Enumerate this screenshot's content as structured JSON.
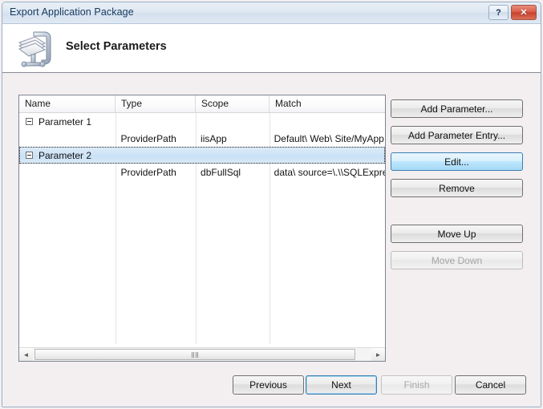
{
  "window": {
    "title": "Export Application Package",
    "help_button": "?",
    "close_button": "✕"
  },
  "header": {
    "title": "Select Parameters",
    "icon": "package-clamp-icon"
  },
  "grid": {
    "columns": [
      "Name",
      "Type",
      "Scope",
      "Match"
    ],
    "rows": [
      {
        "kind": "group",
        "name": "Parameter 1",
        "type": "",
        "scope": "",
        "match": "",
        "selected": false
      },
      {
        "kind": "entry",
        "name": "",
        "type": "ProviderPath",
        "scope": "iisApp",
        "match": "Default\\ Web\\ Site/MyApp",
        "selected": false
      },
      {
        "kind": "group",
        "name": "Parameter 2",
        "type": "",
        "scope": "",
        "match": "",
        "selected": true
      },
      {
        "kind": "entry",
        "name": "",
        "type": "ProviderPath",
        "scope": "dbFullSql",
        "match": "data\\ source=\\.\\\\SQLExpre",
        "selected": false
      }
    ],
    "scrollbar": {
      "left_arrow": "◄",
      "right_arrow": "►"
    }
  },
  "side_buttons": [
    {
      "label": "Add Parameter...",
      "state": "normal"
    },
    {
      "label": "Add Parameter Entry...",
      "state": "normal"
    },
    {
      "label": "Edit...",
      "state": "hover"
    },
    {
      "label": "Remove",
      "state": "normal"
    },
    {
      "label": "Move Up",
      "state": "normal"
    },
    {
      "label": "Move Down",
      "state": "disabled"
    }
  ],
  "nav_buttons": [
    {
      "label": "Previous",
      "state": "normal"
    },
    {
      "label": "Next",
      "state": "default"
    },
    {
      "label": "Finish",
      "state": "disabled"
    },
    {
      "label": "Cancel",
      "state": "normal"
    }
  ],
  "colors": {
    "titlebar": "#dde7f1",
    "body": "#f3eff1",
    "selection": "#c7e0f4",
    "accent": "#3c7fb1",
    "close_button": "#c8412c"
  }
}
